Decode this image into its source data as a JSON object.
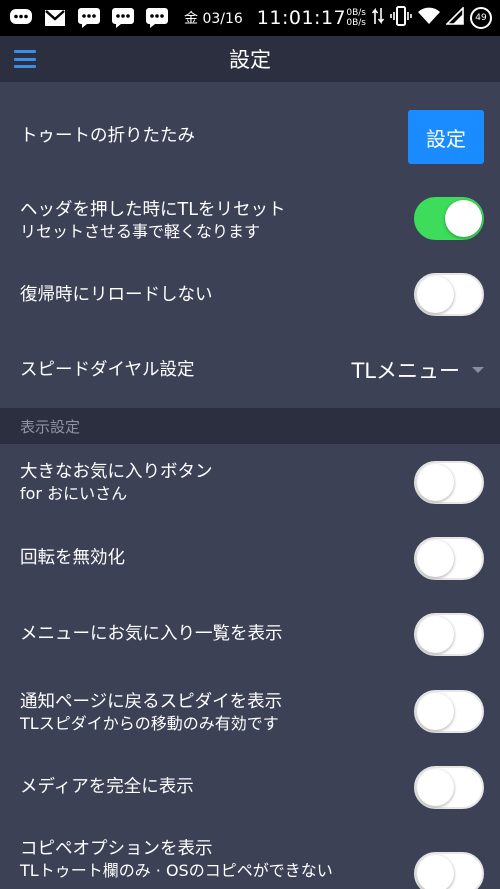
{
  "status_bar": {
    "date": "金 03/16",
    "time": "11:01:17",
    "speed_up": "0B/s",
    "speed_down": "0B/s",
    "battery": "49"
  },
  "app_bar": {
    "title": "設定"
  },
  "settings": {
    "fold_toot": {
      "label": "トゥートの折りたたみ",
      "button_label": "設定"
    },
    "header_reset": {
      "label": "ヘッダを押した時にTLをリセット",
      "sub": "リセットさせる事で軽くなります",
      "enabled": true
    },
    "no_reload": {
      "label": "復帰時にリロードしない",
      "enabled": false
    },
    "speed_dial": {
      "label": "スピードダイヤル設定",
      "value": "TLメニュー"
    }
  },
  "display_section": {
    "header": "表示設定",
    "items": [
      {
        "label": "大きなお気に入りボタン",
        "sub": "for おにいさん",
        "enabled": false
      },
      {
        "label": "回転を無効化",
        "enabled": false
      },
      {
        "label": "メニューにお気に入り一覧を表示",
        "enabled": false
      },
      {
        "label": "通知ページに戻るスピダイを表示",
        "sub": "TLスピダイからの移動のみ有効です",
        "enabled": false
      },
      {
        "label": "メディアを完全に表示",
        "enabled": false
      },
      {
        "label": "コピペオプションを表示",
        "sub": "TLトゥート欄のみ · OSのコピペができない",
        "enabled": false
      }
    ]
  },
  "colors": {
    "background": "#3d4156",
    "header_bar": "#2c2f3f",
    "accent_blue": "#1a8cff",
    "toggle_on": "#3ddc5a"
  }
}
